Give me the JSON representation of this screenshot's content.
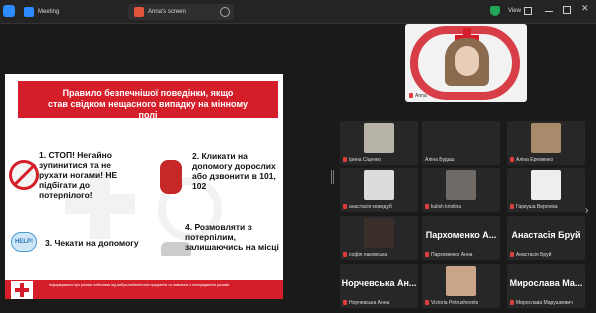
{
  "window": {
    "meeting_tab": "Meeting",
    "screen_tab": "Anna's screen",
    "view_label": "View"
  },
  "slide": {
    "title_line1": "Правило безпечнішої поведінки, якщо",
    "title_line2": "став свідком нещасного випадку на мінному полі",
    "item1": "1. СТОП! Негайно зупинитися та не рухати ногами! НЕ підбігати до потерпілого!",
    "item2": "2. Кликати на допомогу дорослих або дзвонити в 101, 102",
    "item3": "3. Чекати на допомогу",
    "item4": "4. Розмовляти з потерпілим, залишаючись на місці",
    "help_label": "HELP!",
    "footer_text": "Інформування про ризики небезпеки від вибухонебезпечних предметів та навчання з попередження ризиків"
  },
  "speaker": {
    "name": "Anna"
  },
  "participants": [
    {
      "name": "Ірина Сіценко",
      "muted": true,
      "video": true
    },
    {
      "name": "Аліна Будаш",
      "muted": false,
      "video": false
    },
    {
      "name": "Аліна Еременко",
      "muted": true,
      "video": true
    },
    {
      "name": "анастасія кожедуб",
      "muted": true,
      "video": true
    },
    {
      "name": "kulish kristina",
      "muted": true,
      "video": true
    },
    {
      "name": "Гаркуша Вероніка",
      "muted": true,
      "video": true
    },
    {
      "name": "софія лаковська",
      "muted": true,
      "video": true
    },
    {
      "name": "Пархоменко Анна",
      "display": "Пархоменко А...",
      "muted": true,
      "video": false
    },
    {
      "name": "Анастасія Бруй",
      "display": "Анастасія Бруй",
      "muted": true,
      "video": false
    },
    {
      "name": "Норчевська Анна",
      "display": "Норчевська Ан...",
      "muted": true,
      "video": false
    },
    {
      "name": "Victoria Petrushevets",
      "muted": true,
      "video": true
    },
    {
      "name": "Мирослава Марушкевич",
      "display": "Мирослава Ма...",
      "muted": true,
      "video": false
    }
  ],
  "colors": {
    "accent_red": "#d41f2a",
    "background": "#1a1a1a"
  }
}
